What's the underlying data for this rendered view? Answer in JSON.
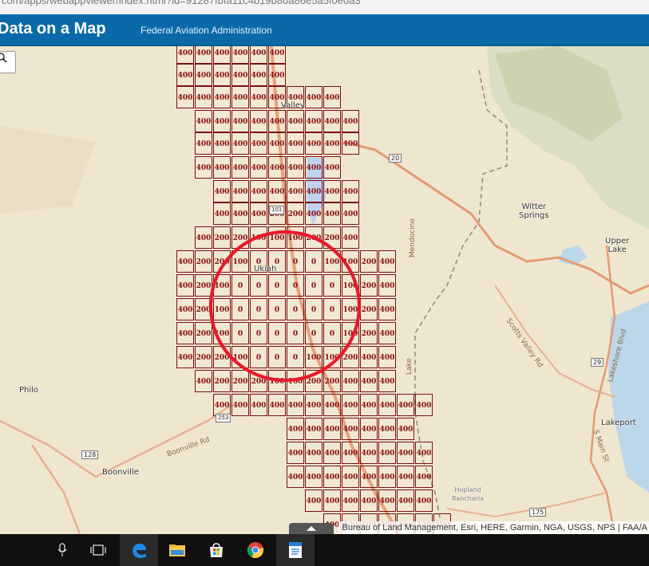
{
  "browser": {
    "url_partial": "com/apps/webappviewer/index.html?id=91287fbfa11c4b19b80a86e5a5f0e0a3"
  },
  "header": {
    "title": "Data on a Map",
    "agency": "Federal Aviation Administration"
  },
  "map": {
    "places": {
      "ukiah": "Ukiah",
      "valley": "Valley",
      "witter": "Witter\nSprings",
      "upper_lake": "Upper\nLake",
      "philo": "Philo",
      "boonville": "Boonville",
      "lakeport": "Lakeport",
      "hopland": "Hopland\nRancheria",
      "mendocino": "Mendocino",
      "lake": "Lake",
      "scotts_valley": "Scotts Valley Rd",
      "boonville_rd": "Boonville Rd",
      "lakeshore": "Lakeshore Blvd",
      "s_main": "S Main St"
    },
    "routes": {
      "r20": "20",
      "r101": "101",
      "r253": "253",
      "r128": "128",
      "r29": "29",
      "r175": "175"
    },
    "attribution": "Bureau of Land Management, Esri, HERE, Garmin, NGA, USGS, NPS | FAA/A",
    "circle_color": "#e8192c",
    "cell_color": "#7a0f12",
    "grid_rows": [
      {
        "values": [
          "400",
          "400",
          "400",
          "400",
          "400",
          "400"
        ]
      },
      {
        "values": [
          "400",
          "400",
          "400",
          "400",
          "400",
          "400"
        ]
      },
      {
        "values": [
          "400",
          "400",
          "400",
          "400",
          "400",
          "400",
          "400",
          "400",
          "400"
        ]
      },
      {
        "values": [
          "400",
          "400",
          "400",
          "400",
          "400",
          "400",
          "400",
          "400",
          "400"
        ]
      },
      {
        "values": [
          "400",
          "400",
          "400",
          "400",
          "400",
          "400",
          "400",
          "400",
          "400"
        ]
      },
      {
        "values": [
          "400",
          "400",
          "400",
          "400",
          "400",
          "400",
          "400",
          "400"
        ]
      },
      {
        "values": [
          "400",
          "400",
          "400",
          "400",
          "400",
          "400",
          "400",
          "400"
        ]
      },
      {
        "values": [
          "400",
          "400",
          "400",
          "200",
          "200",
          "400",
          "400",
          "400"
        ]
      },
      {
        "values": [
          "400",
          "200",
          "200",
          "100",
          "100",
          "100",
          "200",
          "200",
          "400"
        ]
      },
      {
        "values": [
          "400",
          "200",
          "200",
          "100",
          "0",
          "0",
          "0",
          "0",
          "100",
          "100",
          "200",
          "400"
        ]
      },
      {
        "values": [
          "400",
          "200",
          "100",
          "0",
          "0",
          "0",
          "0",
          "0",
          "0",
          "100",
          "200",
          "400"
        ]
      },
      {
        "values": [
          "400",
          "200",
          "100",
          "0",
          "0",
          "0",
          "0",
          "0",
          "0",
          "100",
          "200",
          "400"
        ]
      },
      {
        "values": [
          "400",
          "200",
          "100",
          "0",
          "0",
          "0",
          "0",
          "0",
          "0",
          "100",
          "200",
          "400"
        ]
      },
      {
        "values": [
          "400",
          "200",
          "200",
          "100",
          "0",
          "0",
          "0",
          "100",
          "100",
          "200",
          "400",
          "400"
        ]
      },
      {
        "values": [
          "400",
          "200",
          "200",
          "200",
          "100",
          "100",
          "200",
          "200",
          "400",
          "400",
          "400"
        ]
      },
      {
        "values": [
          "400",
          "400",
          "400",
          "400",
          "400",
          "400",
          "400",
          "400",
          "400",
          "400",
          "400",
          "400"
        ]
      },
      {
        "values": [
          "400",
          "400",
          "400",
          "400",
          "400",
          "400",
          "400"
        ]
      },
      {
        "values": [
          "400",
          "400",
          "400",
          "400",
          "400",
          "400",
          "400",
          "400"
        ]
      },
      {
        "values": [
          "400",
          "400",
          "400",
          "400",
          "400",
          "400",
          "400",
          "400"
        ]
      },
      {
        "values": [
          "400",
          "400",
          "400",
          "400",
          "400",
          "400",
          "400"
        ]
      },
      {
        "values": [
          "400",
          "400",
          "400",
          "400",
          "400",
          "400",
          "400"
        ]
      }
    ]
  },
  "taskbar": {
    "items": [
      "microphone-icon",
      "task-view-icon",
      "edge-icon",
      "file-explorer-icon",
      "store-icon",
      "chrome-icon",
      "document-icon"
    ]
  }
}
